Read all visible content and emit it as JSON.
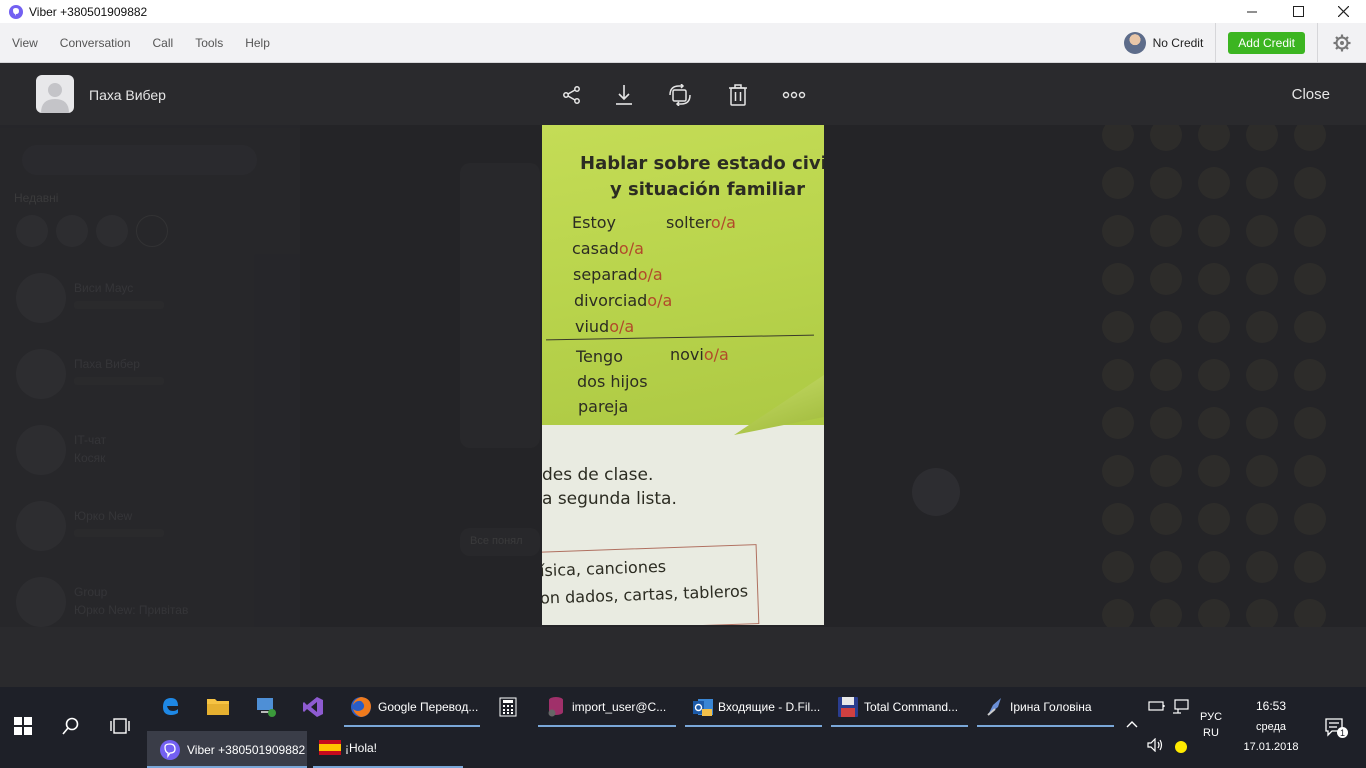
{
  "window": {
    "title": "Viber +380501909882"
  },
  "menu": {
    "items": [
      "View",
      "Conversation",
      "Call",
      "Tools",
      "Help"
    ],
    "no_credit": "No Credit",
    "add_credit": "Add Credit"
  },
  "viewer": {
    "contact_name": "Паха Вибер",
    "close_label": "Close",
    "tools": [
      "share-icon",
      "download-icon",
      "rotate-icon",
      "trash-icon",
      "more-icon"
    ]
  },
  "photo": {
    "title_line1": "Hablar sobre estado civil",
    "title_line2": "y situación familiar",
    "rows": [
      {
        "stem": "Estoy",
        "suffix": ""
      },
      {
        "stem": "solter",
        "suffix": "o/a"
      },
      {
        "stem": "casad",
        "suffix": "o/a"
      },
      {
        "stem": "separad",
        "suffix": "o/a"
      },
      {
        "stem": "divorciad",
        "suffix": "o/a"
      },
      {
        "stem": "viud",
        "suffix": "o/a"
      },
      {
        "stem": "Tengo",
        "suffix": ""
      },
      {
        "stem": "novi",
        "suffix": "o/a"
      },
      {
        "stem": "dos hijos",
        "suffix": ""
      },
      {
        "stem": "pareja",
        "suffix": ""
      }
    ],
    "lower_line1": "des de clase.",
    "lower_line2": "a segunda lista.",
    "box_line1": "ísica, canciones",
    "box_line2": "on dados, cartas, tableros"
  },
  "ghost": {
    "recent_label": "Недавні",
    "chats": [
      "Виси Маус",
      "Паха Вибер",
      "IT-чат",
      "Юрко New",
      "Group"
    ],
    "chat_preview_it": "Косяк",
    "group_preview": "Юрко New: Привітав",
    "bubble_text": "Все понял"
  },
  "taskbar": {
    "apps": [
      {
        "label": "Google Перевод...",
        "icon": "firefox-icon"
      },
      {
        "label": "import_user@C...",
        "icon": "db-icon"
      },
      {
        "label": "Входящие - D.Fil...",
        "icon": "outlook-icon"
      },
      {
        "label": "Total Command...",
        "icon": "floppy-icon"
      },
      {
        "label": "Ірина Головіна",
        "icon": "messenger-icon"
      }
    ],
    "row2": [
      {
        "label": "Viber +380501909882",
        "icon": "viber-icon"
      },
      {
        "label": "¡Hola!",
        "icon": "spain-flag-icon"
      }
    ],
    "lang_top": "РУС",
    "lang_bottom": "RU",
    "time": "16:53",
    "day": "среда",
    "date": "17.01.2018",
    "notification_count": "1"
  },
  "colors": {
    "viber_purple": "#7360f2",
    "add_credit_green": "#3cb521",
    "viewer_bg": "#242427",
    "taskbar_bg": "#1e2028"
  }
}
